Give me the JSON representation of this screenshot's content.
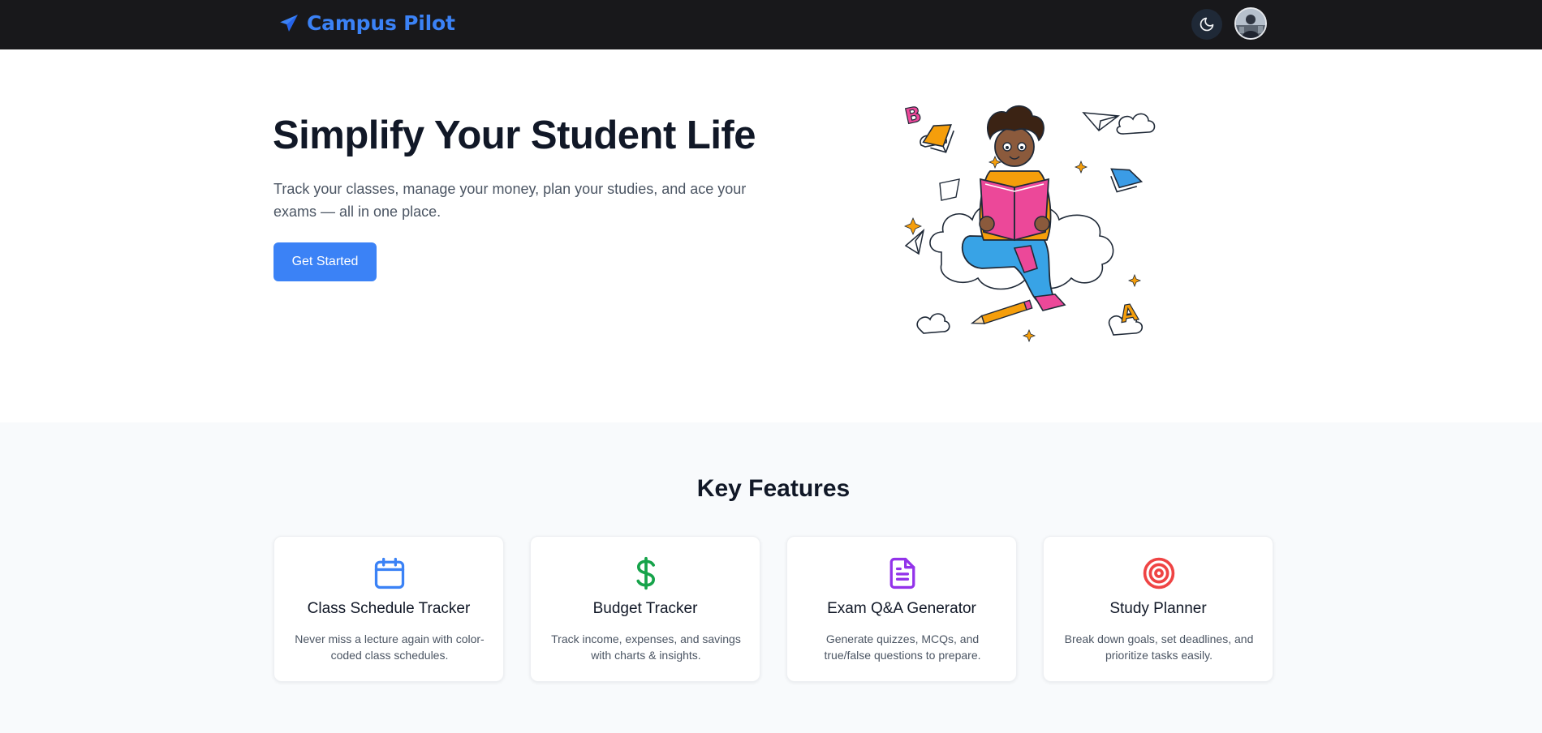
{
  "navbar": {
    "brand": "Campus Pilot",
    "brand_icon": "paper-plane-icon",
    "theme_toggle_icon": "moon-icon",
    "avatar_icon": "user-avatar",
    "brand_color": "#3b82f6",
    "background": "#18181b"
  },
  "hero": {
    "title": "Simplify Your Student Life",
    "subtitle": "Track your classes, manage your money, plan your studies, and ace your exams — all in one place.",
    "cta_label": "Get Started",
    "illustration": "student-reading-book-on-cloud-illustration"
  },
  "features": {
    "title": "Key Features",
    "items": [
      {
        "title": "Class Schedule Tracker",
        "description": "Never miss a lecture again with color-coded class schedules.",
        "icon": "calendar-icon",
        "color": "#3b82f6"
      },
      {
        "title": "Budget Tracker",
        "description": "Track income, expenses, and savings with charts & insights.",
        "icon": "dollar-icon",
        "color": "#16a34a"
      },
      {
        "title": "Exam Q&A Generator",
        "description": "Generate quizzes, MCQs, and true/false questions to prepare.",
        "icon": "document-icon",
        "color": "#9333ea"
      },
      {
        "title": "Study Planner",
        "description": "Break down goals, set deadlines, and prioritize tasks easily.",
        "icon": "target-icon",
        "color": "#ef4444"
      }
    ]
  },
  "colors": {
    "accent": "#3b82f6",
    "heading": "#111827",
    "body_text": "#4b5563",
    "section_bg": "#f8fafc"
  }
}
